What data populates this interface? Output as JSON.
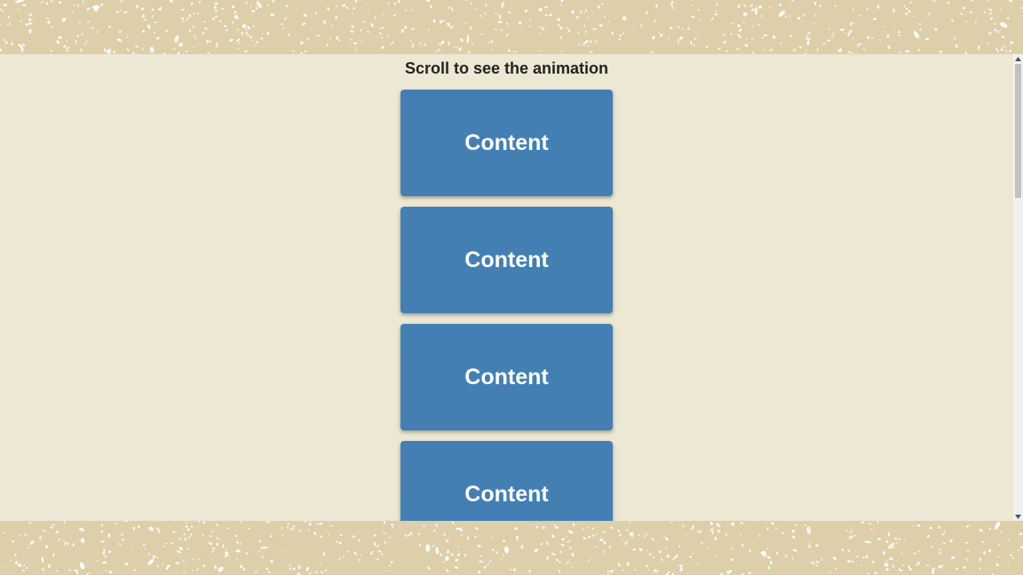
{
  "page": {
    "title": "Scroll to see the animation"
  },
  "cards": [
    {
      "label": "Content"
    },
    {
      "label": "Content"
    },
    {
      "label": "Content"
    },
    {
      "label": "Content"
    }
  ],
  "colors": {
    "background": "#ece8d3",
    "border_pattern": "#ddcfaa",
    "card": "#437fb3",
    "card_text": "#ffffff",
    "title_text": "#222222"
  },
  "icons": {
    "scroll_up": "triangle-up-icon",
    "scroll_down": "triangle-down-icon"
  },
  "scrollbar": {
    "position_fraction": 0.0
  }
}
